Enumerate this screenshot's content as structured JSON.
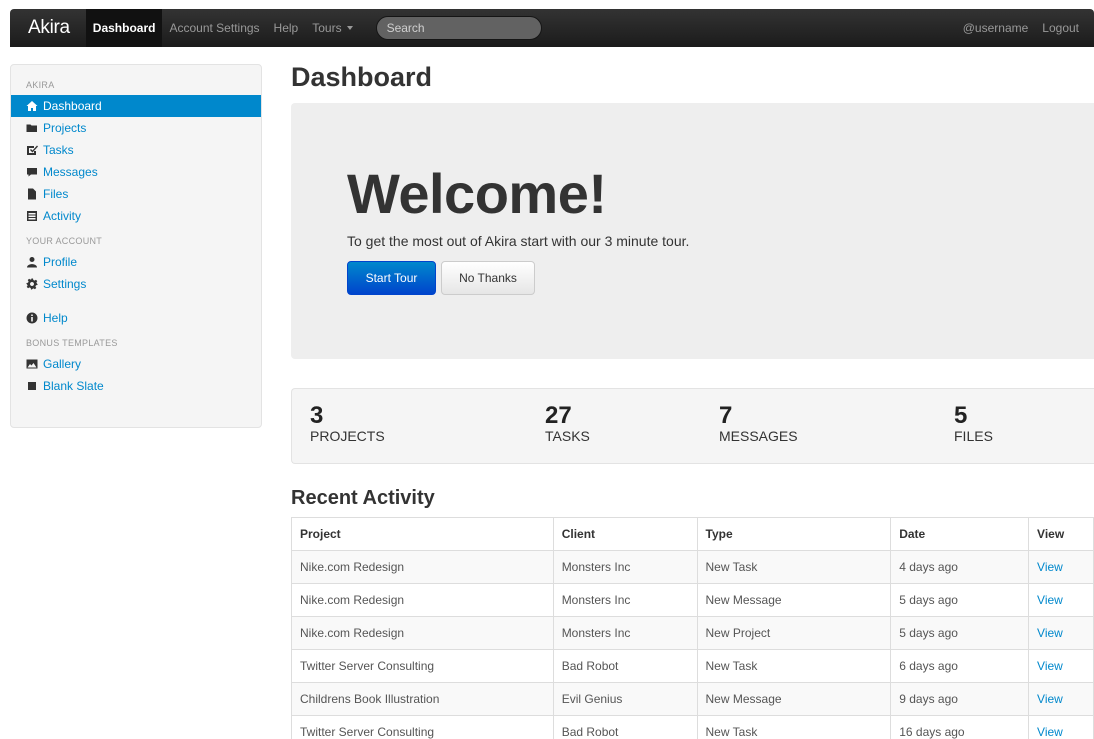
{
  "navbar": {
    "brand": "Akira",
    "items": [
      {
        "label": "Dashboard",
        "active": true
      },
      {
        "label": "Account Settings",
        "active": false
      },
      {
        "label": "Help",
        "active": false
      },
      {
        "label": "Tours",
        "active": false
      }
    ],
    "search_placeholder": "Search",
    "username": "@username",
    "logout": "Logout"
  },
  "sidebar": {
    "sections": [
      {
        "header": "Akira",
        "items": [
          {
            "label": "Dashboard",
            "icon": "home-icon",
            "active": true
          },
          {
            "label": "Projects",
            "icon": "folder-icon"
          },
          {
            "label": "Tasks",
            "icon": "check-icon"
          },
          {
            "label": "Messages",
            "icon": "comment-icon"
          },
          {
            "label": "Files",
            "icon": "file-icon"
          },
          {
            "label": "Activity",
            "icon": "list-icon"
          }
        ]
      },
      {
        "header": "Your Account",
        "items": [
          {
            "label": "Profile",
            "icon": "user-icon"
          },
          {
            "label": "Settings",
            "icon": "cog-icon"
          }
        ]
      },
      {
        "header": "",
        "items": [
          {
            "label": "Help",
            "icon": "info-icon"
          }
        ]
      },
      {
        "header": "Bonus Templates",
        "items": [
          {
            "label": "Gallery",
            "icon": "picture-icon"
          },
          {
            "label": "Blank Slate",
            "icon": "stop-icon"
          }
        ]
      }
    ]
  },
  "main": {
    "title": "Dashboard",
    "hero": {
      "heading": "Welcome!",
      "text": "To get the most out of Akira start with our 3 minute tour.",
      "primary_button": "Start Tour",
      "secondary_button": "No Thanks"
    },
    "stats": [
      {
        "value": "3",
        "label": "Projects"
      },
      {
        "value": "27",
        "label": "Tasks"
      },
      {
        "value": "7",
        "label": "Messages"
      },
      {
        "value": "5",
        "label": "Files"
      }
    ],
    "activity": {
      "title": "Recent Activity",
      "columns": [
        "Project",
        "Client",
        "Type",
        "Date",
        "View"
      ],
      "rows": [
        [
          "Nike.com Redesign",
          "Monsters Inc",
          "New Task",
          "4 days ago",
          "View"
        ],
        [
          "Nike.com Redesign",
          "Monsters Inc",
          "New Message",
          "5 days ago",
          "View"
        ],
        [
          "Nike.com Redesign",
          "Monsters Inc",
          "New Project",
          "5 days ago",
          "View"
        ],
        [
          "Twitter Server Consulting",
          "Bad Robot",
          "New Task",
          "6 days ago",
          "View"
        ],
        [
          "Childrens Book Illustration",
          "Evil Genius",
          "New Message",
          "9 days ago",
          "View"
        ],
        [
          "Twitter Server Consulting",
          "Bad Robot",
          "New Task",
          "16 days ago",
          "View"
        ]
      ]
    }
  },
  "colors": {
    "accent": "#0088cc",
    "primary_button": "#0044cc",
    "navbar": "#1b1b1b",
    "hero_bg": "#eeeeee"
  }
}
